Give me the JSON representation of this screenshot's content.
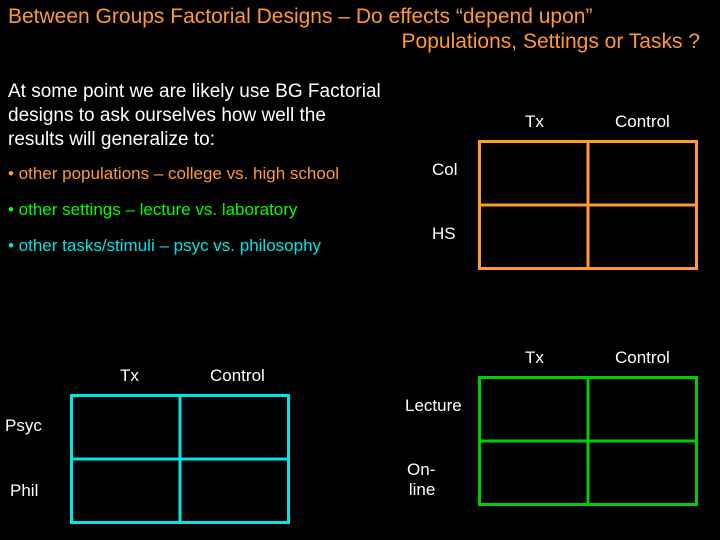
{
  "title_line1": "Between Groups Factorial Designs – Do effects “depend upon”",
  "title_line2": "Populations, Settings or Tasks ?",
  "intro": "At some point we are likely use BG Factorial designs to ask ourselves how well the results will generalize to:",
  "bullets": {
    "pop": "• other populations – college vs. high school",
    "set": "• other settings – lecture vs. laboratory",
    "task": "• other tasks/stimuli – psyc vs. philosophy"
  },
  "labels": {
    "tx": "Tx",
    "control": "Control",
    "col": "Col",
    "hs": "HS",
    "lecture": "Lecture",
    "online": "On-line",
    "psyc": "Psyc",
    "phil": "Phil"
  }
}
